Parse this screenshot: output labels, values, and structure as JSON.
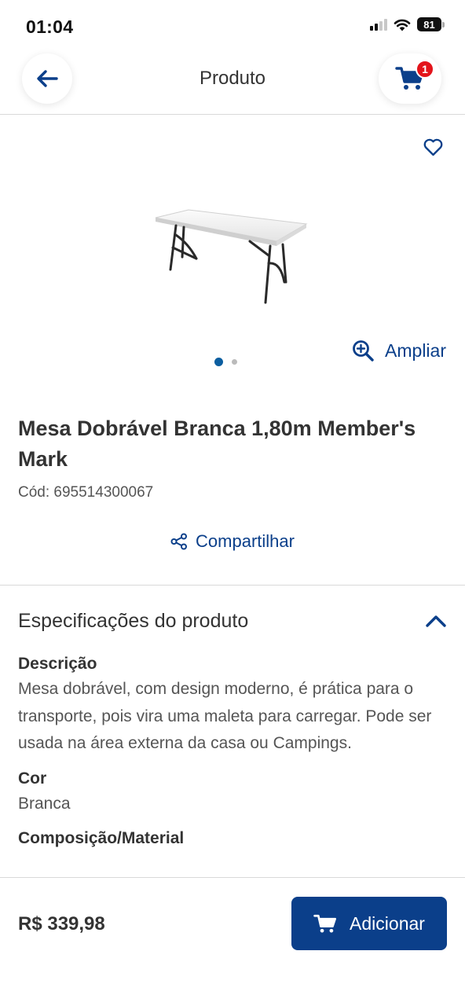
{
  "status_bar": {
    "time": "01:04",
    "battery": "81"
  },
  "header": {
    "title": "Produto",
    "cart_count": "1"
  },
  "gallery": {
    "zoom_label": "Ampliar",
    "image_count": 2,
    "active_index": 0
  },
  "product": {
    "title": "Mesa Dobrável Branca 1,80m Member's Mark",
    "code": "Cód: 695514300067",
    "share_label": "Compartilhar"
  },
  "specs": {
    "section_title": "Especificações do produto",
    "items": [
      {
        "label": "Descrição",
        "value": "Mesa dobrável, com design moderno, é prática para o transporte, pois vira uma maleta para carregar. Pode ser usada na área externa da casa ou Campings."
      },
      {
        "label": "Cor",
        "value": "Branca"
      },
      {
        "label": "Composição/Material",
        "value": ""
      }
    ]
  },
  "footer": {
    "price": "R$ 339,98",
    "add_label": "Adicionar"
  },
  "colors": {
    "brand_blue": "#0b3f8a",
    "badge_red": "#e3141b",
    "dot_active": "#0b5ea0"
  }
}
